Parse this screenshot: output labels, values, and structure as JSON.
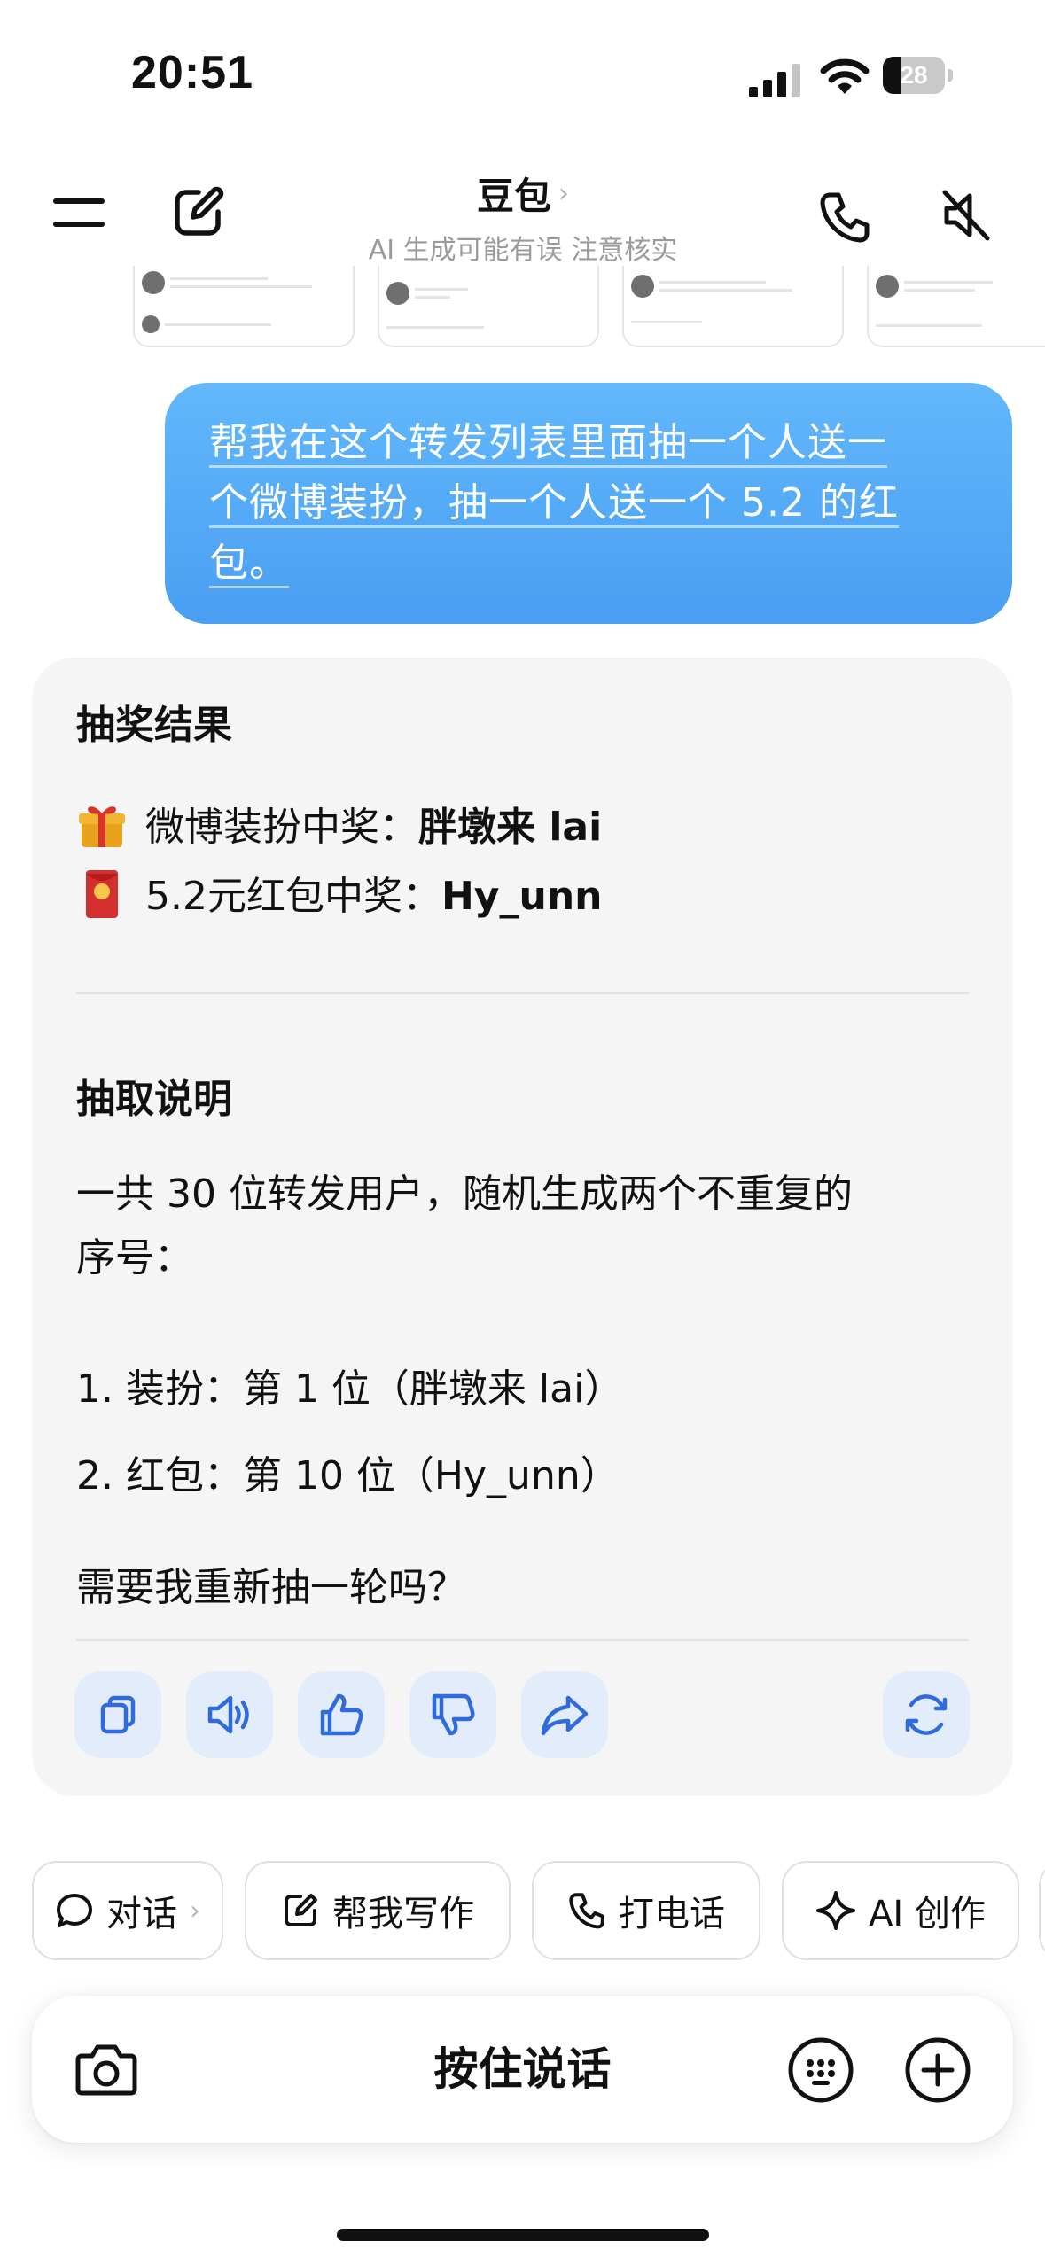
{
  "status_bar": {
    "time": "20:51",
    "battery": "28",
    "battery_level": 0.28
  },
  "header": {
    "title": "豆包",
    "title_chevron": "›",
    "subtitle": "AI 生成可能有误 注意核实",
    "menu_icon": "menu-icon",
    "new_chat_icon": "edit-icon",
    "phone_icon": "phone-icon",
    "mute_icon": "speaker-muted-icon"
  },
  "user_message": {
    "line1": "帮我在这个转发列表里面抽一个人送一",
    "line2": "个微博装扮，抽一个人送一个 5.2 的红",
    "line3": "包。"
  },
  "ai_message": {
    "result_heading": "抽奖结果",
    "prize1_prefix": "微博装扮中奖：",
    "prize1_winner": "胖墩来 lai",
    "prize2_prefix": "5.2元红包中奖：",
    "prize2_winner": "Hy_unn",
    "method_heading": "抽取说明",
    "method_line1": "一共 30 位转发用户，随机生成两个不重复的",
    "method_line2": "序号：",
    "item1": "1. 装扮：第 1 位（胖墩来 lai）",
    "item2": "2. 红包：第 10 位（Hy_unn）",
    "followup": "需要我重新抽一轮吗？",
    "actions": [
      "copy-icon",
      "speaker-icon",
      "thumbs-up-icon",
      "thumbs-down-icon",
      "share-icon",
      "refresh-icon"
    ]
  },
  "chips": [
    {
      "label": "对话",
      "chevron": "›",
      "icon": "chat-bubble-icon"
    },
    {
      "label": "帮我写作",
      "icon": "pen-square-icon"
    },
    {
      "label": "打电话",
      "icon": "phone-icon"
    },
    {
      "label": "AI 创作",
      "icon": "sparkle-icon"
    }
  ],
  "input": {
    "label": "按住说话",
    "camera_icon": "camera-icon",
    "keyboard_icon": "keyboard-icon",
    "plus_icon": "plus-circle-icon"
  }
}
